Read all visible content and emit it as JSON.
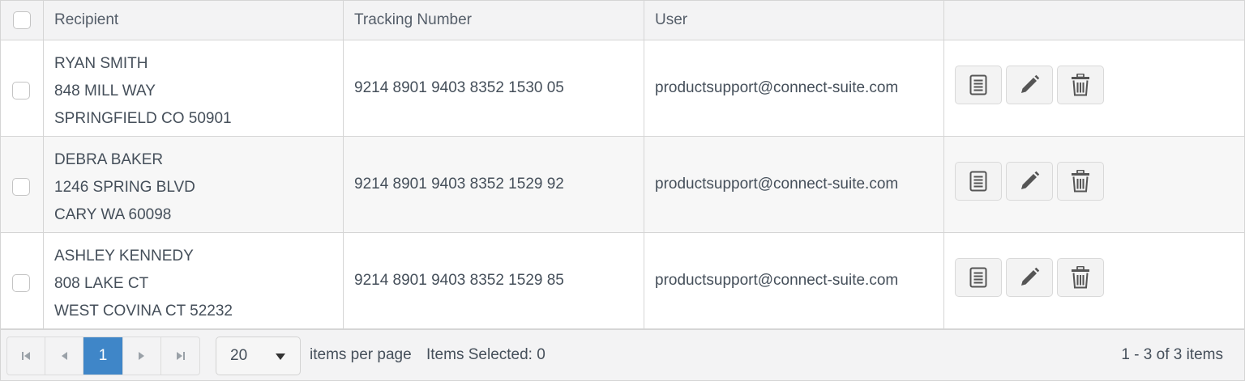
{
  "table": {
    "columns": [
      "Recipient",
      "Tracking Number",
      "User",
      ""
    ],
    "rows": [
      {
        "recipient": [
          "RYAN SMITH",
          "848 MILL WAY",
          "SPRINGFIELD CO 50901"
        ],
        "tracking": "9214 8901 9403 8352 1530 05",
        "user": "productsupport@connect-suite.com"
      },
      {
        "recipient": [
          "DEBRA BAKER",
          "1246 SPRING BLVD",
          "CARY WA 60098"
        ],
        "tracking": "9214 8901 9403 8352 1529 92",
        "user": "productsupport@connect-suite.com"
      },
      {
        "recipient": [
          "ASHLEY KENNEDY",
          "808 LAKE CT",
          "WEST COVINA CT 52232"
        ],
        "tracking": "9214 8901 9403 8352 1529 85",
        "user": "productsupport@connect-suite.com"
      }
    ],
    "row_actions": [
      "document-icon",
      "pencil-icon",
      "trash-icon"
    ]
  },
  "pager": {
    "first_icon": "first-page-icon",
    "prev_icon": "prev-page-icon",
    "current_page": "1",
    "next_icon": "next-page-icon",
    "last_icon": "last-page-icon",
    "page_size": "20",
    "items_per_page_label": "items per page",
    "items_selected_label": "Items Selected: 0",
    "range_label": "1 - 3 of 3 items"
  },
  "colors": {
    "accent": "#3f86c8",
    "header_bg": "#f3f3f4",
    "alt_row_bg": "#f7f7f7"
  }
}
